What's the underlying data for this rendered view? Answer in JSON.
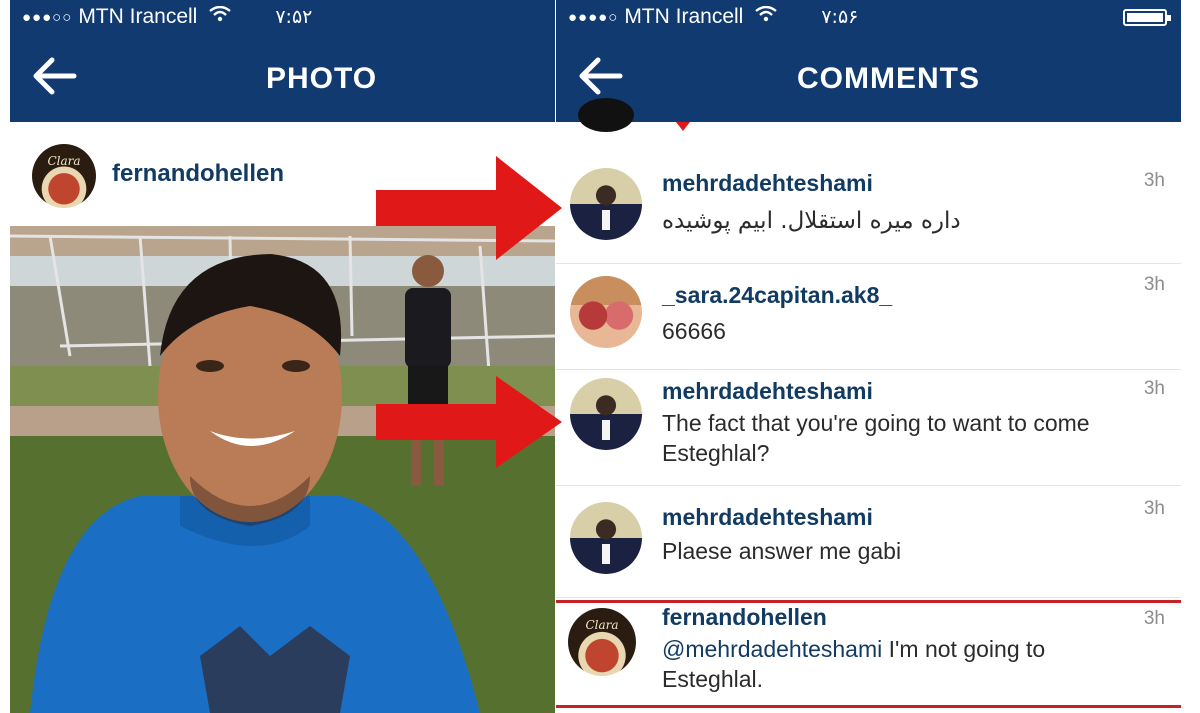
{
  "left_screen": {
    "status": {
      "carrier": "MTN Irancell",
      "time": "۷:۵۲"
    },
    "nav": {
      "title": "PHOTO"
    },
    "post": {
      "username": "fernandohellen",
      "avatar_text": "Clara"
    }
  },
  "right_screen": {
    "status": {
      "carrier": "MTN Irancell",
      "time": "۷:۵۶"
    },
    "nav": {
      "title": "COMMENTS"
    },
    "comments": [
      {
        "user": "mehrdadehteshami",
        "text": "داره میره استقلال. ابیم پوشیده",
        "time": "3h"
      },
      {
        "user": "_sara.24capitan.ak8_",
        "text": "66666",
        "time": "3h"
      },
      {
        "user": "mehrdadehteshami",
        "text": "The fact that you're going to want to come Esteghlal?",
        "time": "3h"
      },
      {
        "user": "mehrdadehteshami",
        "text": "Plaese answer me gabi",
        "time": "3h"
      },
      {
        "user": "fernandohellen",
        "mention": "@mehrdadehteshami",
        "text": " I'm not going to Esteghlal.",
        "time": "3h",
        "avatar_text": "Clara"
      }
    ]
  },
  "colors": {
    "navbar": "#103a70",
    "username": "#123b63",
    "annotation_red": "#e01818"
  },
  "icons": {
    "back": "back-arrow-icon",
    "wifi": "wifi-icon",
    "signal": "signal-dots-icon",
    "battery": "battery-icon"
  }
}
